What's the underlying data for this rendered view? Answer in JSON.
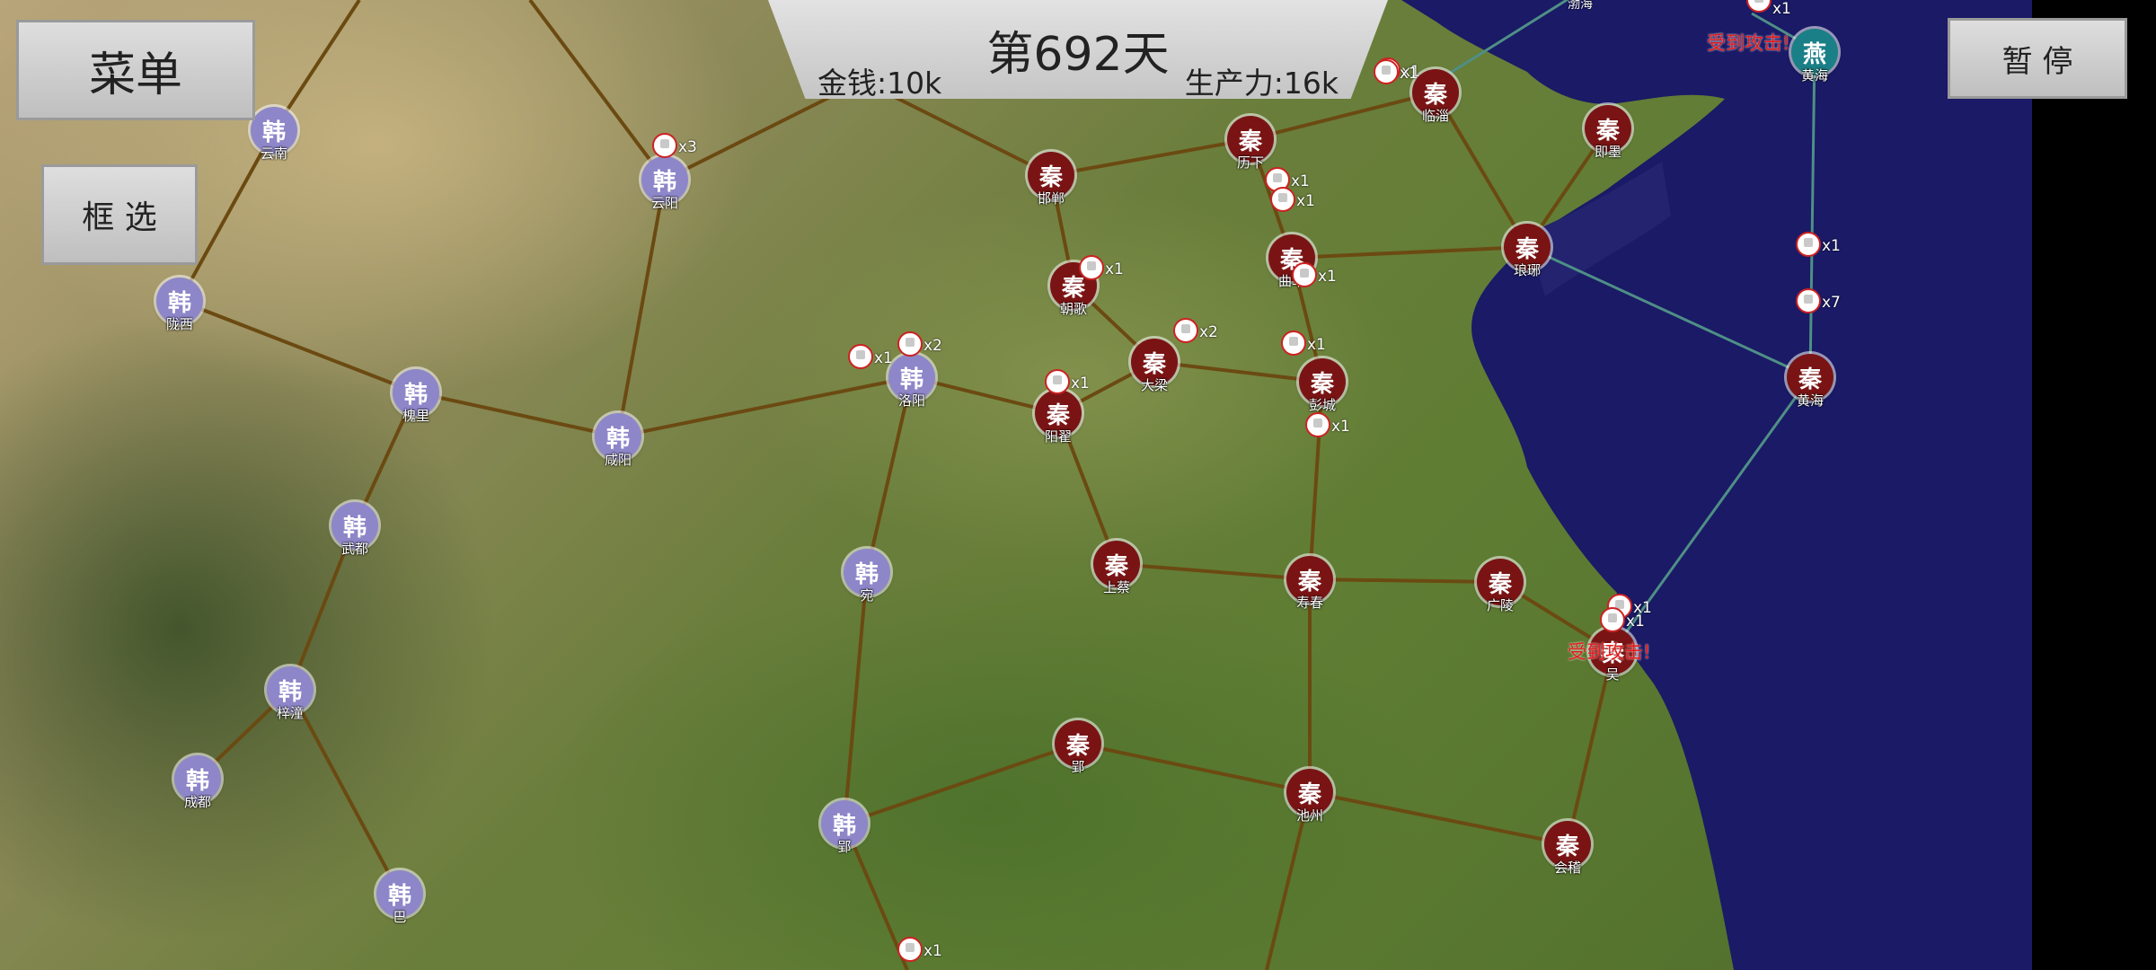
{
  "hud": {
    "day": "第692天",
    "money": "金钱:10k",
    "production": "生产力:16k"
  },
  "buttons": {
    "menu": "菜单",
    "select": "框 选",
    "pause": "暂 停"
  },
  "factions": {
    "han": "韩",
    "qin": "秦",
    "yan": "燕"
  },
  "colors": {
    "han": "#8d86c9",
    "qin": "#7a1414",
    "yan": "#1a7f86",
    "road": "#6b4a12",
    "searoute": "#4f8f86",
    "sea": "#1a1a66"
  },
  "cities": [
    {
      "id": "c1",
      "label": "韩",
      "name": "云南",
      "faction": "han"
    },
    {
      "id": "c2",
      "label": "韩",
      "name": "陇西",
      "faction": "han"
    },
    {
      "id": "c3",
      "label": "韩",
      "name": "云阳",
      "faction": "han"
    },
    {
      "id": "c4",
      "label": "韩",
      "name": "槐里",
      "faction": "han"
    },
    {
      "id": "c5",
      "label": "韩",
      "name": "咸阳",
      "faction": "han"
    },
    {
      "id": "c6",
      "label": "韩",
      "name": "洛阳",
      "faction": "han"
    },
    {
      "id": "c7",
      "label": "韩",
      "name": "武都",
      "faction": "han"
    },
    {
      "id": "c8",
      "label": "韩",
      "name": "宛",
      "faction": "han"
    },
    {
      "id": "c9",
      "label": "韩",
      "name": "梓潼",
      "faction": "han"
    },
    {
      "id": "c10",
      "label": "韩",
      "name": "成都",
      "faction": "han"
    },
    {
      "id": "c11",
      "label": "韩",
      "name": "巴",
      "faction": "han"
    },
    {
      "id": "c12",
      "label": "韩",
      "name": "郢",
      "faction": "han"
    },
    {
      "id": "c13",
      "label": "秦",
      "name": "邯郸",
      "faction": "qin"
    },
    {
      "id": "c14",
      "label": "秦",
      "name": "历下",
      "faction": "qin"
    },
    {
      "id": "c15",
      "label": "秦",
      "name": "临淄",
      "faction": "qin"
    },
    {
      "id": "c16",
      "label": "秦",
      "name": "即墨",
      "faction": "qin"
    },
    {
      "id": "c17",
      "label": "秦",
      "name": "朝歌",
      "faction": "qin"
    },
    {
      "id": "c18",
      "label": "秦",
      "name": "曲阜",
      "faction": "qin"
    },
    {
      "id": "c19",
      "label": "秦",
      "name": "琅琊",
      "faction": "qin"
    },
    {
      "id": "c20",
      "label": "秦",
      "name": "大梁",
      "faction": "qin"
    },
    {
      "id": "c21",
      "label": "秦",
      "name": "彭城",
      "faction": "qin"
    },
    {
      "id": "c22",
      "label": "秦",
      "name": "阳翟",
      "faction": "qin"
    },
    {
      "id": "c23",
      "label": "秦",
      "name": "黄海",
      "faction": "qin"
    },
    {
      "id": "c24",
      "label": "秦",
      "name": "上蔡",
      "faction": "qin"
    },
    {
      "id": "c25",
      "label": "秦",
      "name": "寿春",
      "faction": "qin"
    },
    {
      "id": "c26",
      "label": "秦",
      "name": "广陵",
      "faction": "qin"
    },
    {
      "id": "c27",
      "label": "秦",
      "name": "吴",
      "faction": "qin"
    },
    {
      "id": "c28",
      "label": "秦",
      "name": "郢",
      "faction": "qin"
    },
    {
      "id": "c29",
      "label": "秦",
      "name": "池州",
      "faction": "qin"
    },
    {
      "id": "c30",
      "label": "秦",
      "name": "会稽",
      "faction": "qin"
    },
    {
      "id": "c31",
      "label": "燕",
      "name": "黄海",
      "faction": "yan"
    }
  ],
  "armies": [
    {
      "id": "a1",
      "count": "x3"
    },
    {
      "id": "a2",
      "count": "x1"
    },
    {
      "id": "a3",
      "count": "x1"
    },
    {
      "id": "a4",
      "count": "x1"
    },
    {
      "id": "a5",
      "count": "x1"
    },
    {
      "id": "a6",
      "count": "x1"
    },
    {
      "id": "a7",
      "count": "x2"
    },
    {
      "id": "a8",
      "count": "x1"
    },
    {
      "id": "a9",
      "count": "x2"
    },
    {
      "id": "a10",
      "count": "x1"
    },
    {
      "id": "a11",
      "count": "x1"
    },
    {
      "id": "a12",
      "count": "x1"
    },
    {
      "id": "a13",
      "count": "x1"
    },
    {
      "id": "a14",
      "count": "x7"
    },
    {
      "id": "a15",
      "count": "x1"
    },
    {
      "id": "a16",
      "count": "x1"
    },
    {
      "id": "a17",
      "count": "x1"
    },
    {
      "id": "a18",
      "count": "x1"
    },
    {
      "id": "a19",
      "count": "x1"
    }
  ],
  "alerts": {
    "wu": "受到攻击!",
    "yan": "受到攻击!"
  },
  "sea_labels": {
    "bohai": "渤海"
  }
}
